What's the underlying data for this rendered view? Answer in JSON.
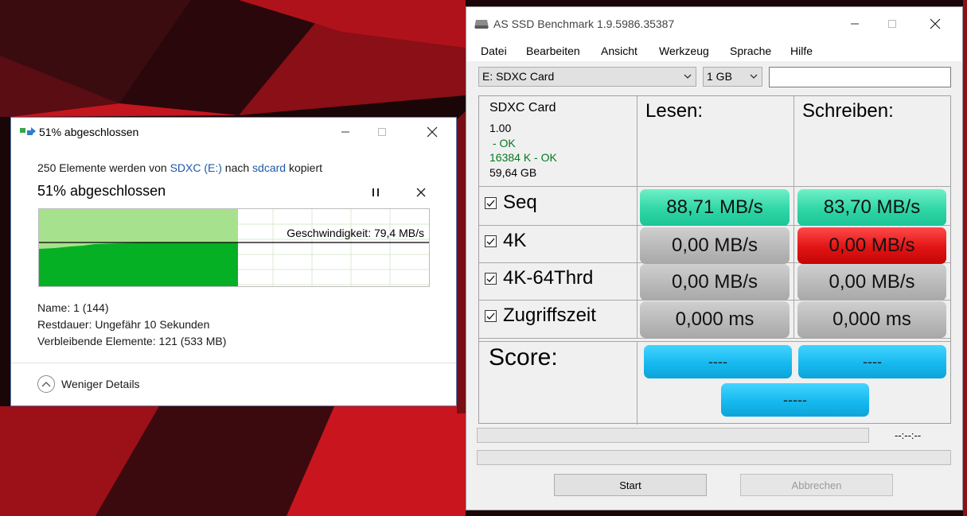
{
  "copy_dialog": {
    "title": "51% abgeschlossen",
    "status": {
      "prefix": "250 Elemente werden von",
      "source": "SDXC (E:)",
      "middle": "nach",
      "destination": "sdcard",
      "suffix": "kopiert"
    },
    "percent_heading": "51% abgeschlossen",
    "progress_fraction": 0.51,
    "speed_label": "Geschwindigkeit: 79,4 MB/s",
    "name": "Name: 1 (144)",
    "remaining_time": "Restdauer: Ungefähr 10 Sekunden",
    "remaining_items": "Verbleibende Elemente: 121 (533 MB)",
    "less_details": "Weniger Details",
    "colors": {
      "progress_green": "#06b025",
      "progress_light": "#a6e28d",
      "link": "#1b5aa6"
    }
  },
  "benchmark": {
    "title": "AS SSD Benchmark 1.9.5986.35387",
    "menu": [
      "Datei",
      "Bearbeiten",
      "Ansicht",
      "Werkzeug",
      "Sprache",
      "Hilfe"
    ],
    "drive_select": "E: SDXC Card",
    "size_select": "1 GB",
    "drive_info": {
      "name": "SDXC Card",
      "version": "1.00",
      "status1": " - OK",
      "status2": "16384 K - OK",
      "capacity": "59,64 GB"
    },
    "col_read": "Lesen:",
    "col_write": "Schreiben:",
    "rows": [
      {
        "label": "Seq",
        "checked": true,
        "read": "88,71 MB/s",
        "write": "83,70 MB/s",
        "read_color": "green",
        "write_color": "green"
      },
      {
        "label": "4K",
        "checked": true,
        "read": "0,00 MB/s",
        "write": "0,00 MB/s",
        "read_color": "gray",
        "write_color": "red"
      },
      {
        "label": "4K-64Thrd",
        "checked": true,
        "read": "0,00 MB/s",
        "write": "0,00 MB/s",
        "read_color": "gray",
        "write_color": "gray"
      },
      {
        "label": "Zugriffszeit",
        "checked": true,
        "read": "0,000 ms",
        "write": "0,000 ms",
        "read_color": "gray",
        "write_color": "gray"
      }
    ],
    "score_label": "Score:",
    "score_read": "----",
    "score_write": "----",
    "score_total": "-----",
    "time_readout": "--:--:--",
    "start_button": "Start",
    "abort_button": "Abbrechen",
    "colors": {
      "ok_text": "#007a1f",
      "green_pill": "#2fd6a6",
      "red_pill": "#e11414",
      "blue_pill": "#16b9ef"
    }
  }
}
